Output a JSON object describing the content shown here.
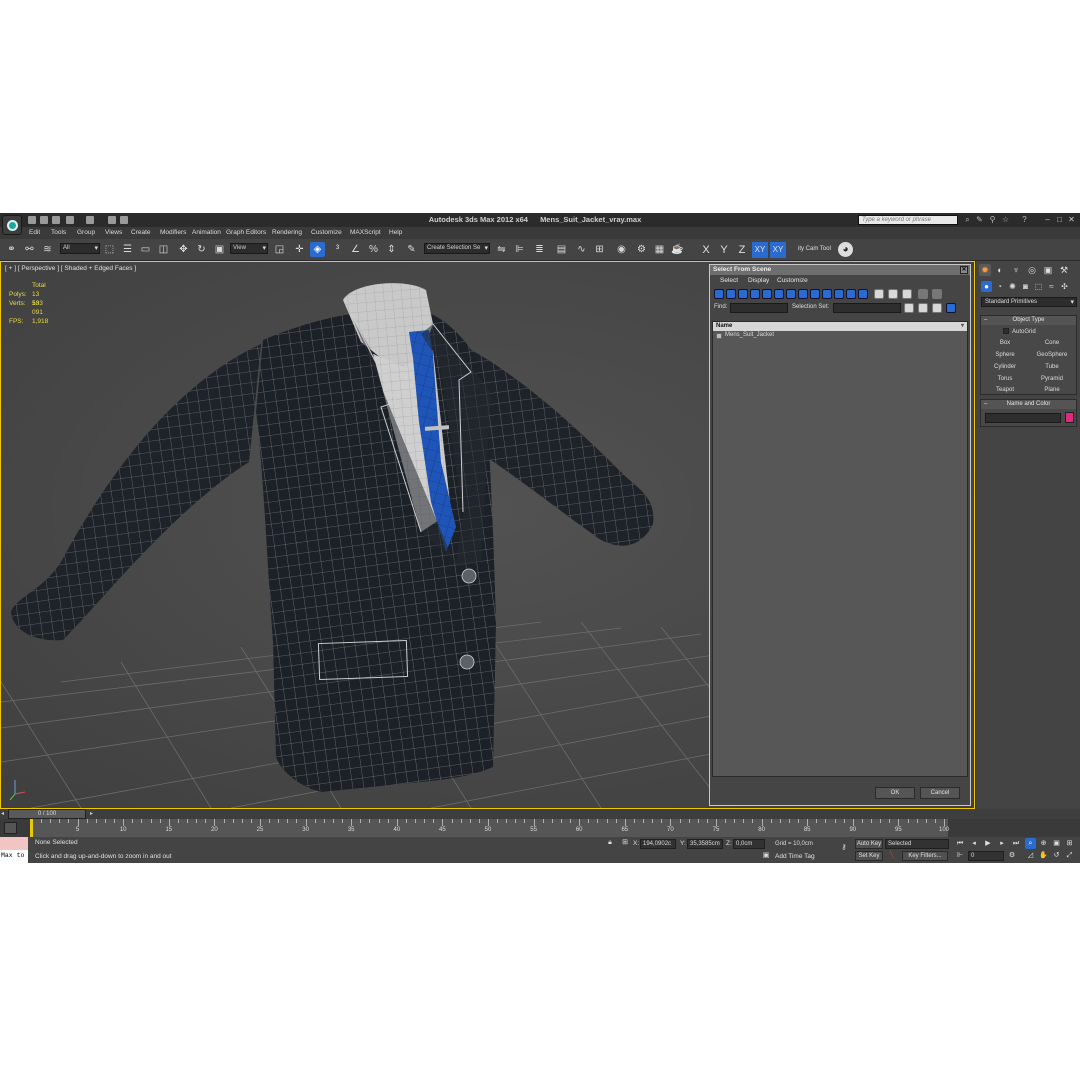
{
  "title_bar": {
    "app_name": "Autodesk 3ds Max  2012 x64",
    "file_name": "Mens_Suit_Jacket_vray.max",
    "search_placeholder": "Type a keyword or phrase"
  },
  "menu": [
    "Edit",
    "Tools",
    "Group",
    "Views",
    "Create",
    "Modifiers",
    "Animation",
    "Graph Editors",
    "Rendering",
    "Customize",
    "MAXScript",
    "Help"
  ],
  "toolbar": {
    "filter_value": "All",
    "refcoord_value": "View",
    "selection_set_placeholder": "Create Selection Se",
    "axes": [
      "X",
      "Y",
      "Z",
      "XY",
      "XY"
    ],
    "cam_tool": "ity Cam Tool"
  },
  "viewport": {
    "label": "[ + ] [ Perspective ] [ Shaded + Edged Faces ]",
    "stats": {
      "header": "Total",
      "polys_label": "Polys:",
      "polys_value": "13 503",
      "verts_label": "Verts:",
      "verts_value": "13 091",
      "fps_label": "FPS:",
      "fps_value": "1,918"
    }
  },
  "dialog": {
    "title": "Select From Scene",
    "menu": [
      "Select",
      "Display",
      "Customize"
    ],
    "find_label": "Find:",
    "selection_set_label": "Selection Set:",
    "column_header": "Name",
    "items": [
      "Mens_Suit_Jacket"
    ],
    "ok": "OK",
    "cancel": "Cancel"
  },
  "command_panel": {
    "category": "Standard Primitives",
    "object_type_title": "Object Type",
    "autogrid": "AutoGrid",
    "primitives": [
      "Box",
      "Cone",
      "Sphere",
      "GeoSphere",
      "Cylinder",
      "Tube",
      "Torus",
      "Pyramid",
      "Teapot",
      "Plane"
    ],
    "name_color_title": "Name and Color",
    "object_color": "#e0287d"
  },
  "timeline": {
    "frame_display": "0 / 100",
    "ticks": [
      "0",
      "5",
      "10",
      "15",
      "20",
      "25",
      "30",
      "35",
      "40",
      "45",
      "50",
      "55",
      "60",
      "65",
      "70",
      "75",
      "80",
      "85",
      "90",
      "95",
      "100"
    ]
  },
  "status": {
    "script_listener": "Max to",
    "selection": "None Selected",
    "prompt": "Click and drag up-and-down to zoom in and out",
    "x_label": "X:",
    "x_value": "194,0902c",
    "y_label": "Y:",
    "y_value": "35,3585cm",
    "z_label": "Z:",
    "z_value": "0,0cm",
    "grid": "Grid = 10,0cm",
    "add_time_tag": "Add Time Tag",
    "auto_key": "Auto Key",
    "set_key": "Set Key",
    "key_mode": "Selected",
    "key_filters": "Key Filters...",
    "current_frame": "0"
  },
  "colors": {
    "viewport_border": "#f0c800",
    "accent_blue": "#2a6bd1",
    "stats_yellow": "#e8dc48",
    "tie_blue": "#1f55b8"
  }
}
